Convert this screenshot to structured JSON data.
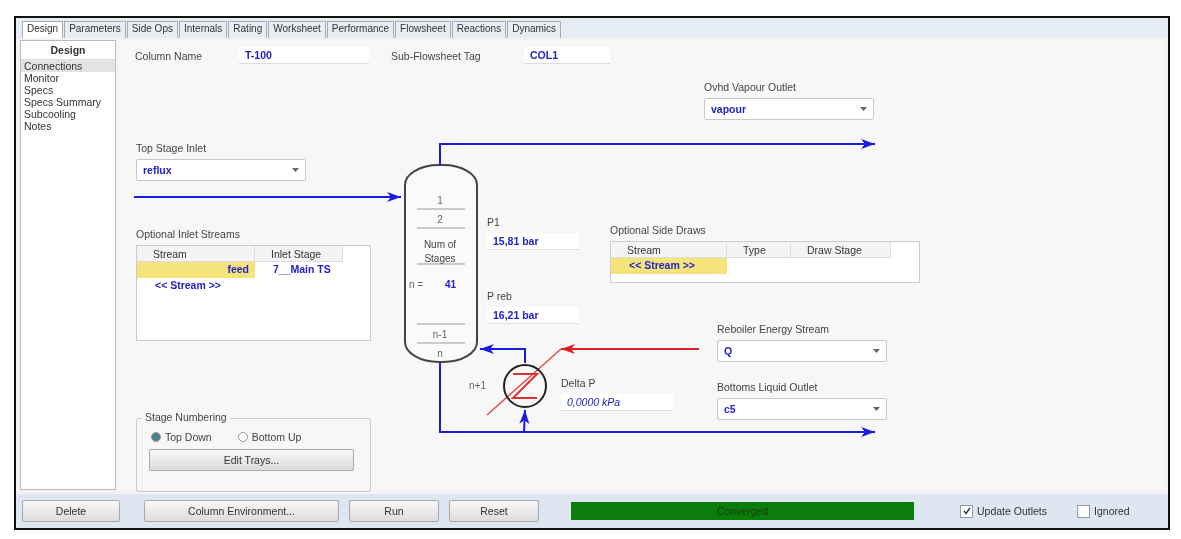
{
  "tabs": [
    {
      "label": "Design",
      "selected": true
    },
    {
      "label": "Parameters",
      "selected": false
    },
    {
      "label": "Side Ops",
      "selected": false
    },
    {
      "label": "Internals",
      "selected": false
    },
    {
      "label": "Rating",
      "selected": false
    },
    {
      "label": "Worksheet",
      "selected": false
    },
    {
      "label": "Performance",
      "selected": false
    },
    {
      "label": "Flowsheet",
      "selected": false
    },
    {
      "label": "Reactions",
      "selected": false
    },
    {
      "label": "Dynamics",
      "selected": false
    }
  ],
  "sidebar": {
    "title": "Design",
    "items": [
      {
        "label": "Connections",
        "selected": true
      },
      {
        "label": "Monitor",
        "selected": false
      },
      {
        "label": "Specs",
        "selected": false
      },
      {
        "label": "Specs Summary",
        "selected": false
      },
      {
        "label": "Subcooling",
        "selected": false
      },
      {
        "label": "Notes",
        "selected": false
      }
    ]
  },
  "column_name": {
    "label": "Column Name",
    "value": "T-100"
  },
  "sub_flowsheet_tag": {
    "label": "Sub-Flowsheet Tag",
    "value": "COL1"
  },
  "ovhd_vapour_outlet": {
    "label": "Ovhd Vapour Outlet",
    "value": "vapour"
  },
  "top_stage_inlet": {
    "label": "Top Stage Inlet",
    "value": "reflux"
  },
  "optional_inlet_streams": {
    "label": "Optional Inlet Streams",
    "columns": [
      "Stream",
      "Inlet Stage"
    ],
    "rows": [
      {
        "stream": "feed",
        "stage": "7__Main TS",
        "selected": true
      },
      {
        "stream": "<< Stream >>",
        "stage": "",
        "selected": false
      }
    ]
  },
  "column": {
    "stages": [
      "1",
      "2"
    ],
    "num_label": "Num of Stages",
    "n_label": "n =",
    "n_value": "41",
    "bottom_stages": [
      "n-1",
      "n"
    ],
    "reboiler_stage": "n+1"
  },
  "p1": {
    "label": "P1",
    "value": "15,81 bar"
  },
  "p_reb": {
    "label": "P reb",
    "value": "16,21 bar"
  },
  "delta_p": {
    "label": "Delta P",
    "value": "0,0000 kPa"
  },
  "optional_side_draws": {
    "label": "Optional Side Draws",
    "columns": [
      "Stream",
      "Type",
      "Draw Stage"
    ],
    "rows": [
      {
        "stream": "<< Stream >>",
        "selected": true
      }
    ]
  },
  "reboiler_energy_stream": {
    "label": "Reboiler Energy Stream",
    "value": "Q"
  },
  "bottoms_liquid_outlet": {
    "label": "Bottoms Liquid Outlet",
    "value": "c5"
  },
  "stage_numbering": {
    "label": "Stage Numbering",
    "options": [
      {
        "label": "Top Down",
        "selected": true
      },
      {
        "label": "Bottom Up",
        "selected": false
      }
    ],
    "button": "Edit Trays..."
  },
  "buttons": [
    "Delete",
    "Column Environment...",
    "Run",
    "Reset"
  ],
  "status": {
    "text": "Converged",
    "color": "#0a7d0a"
  },
  "checks": [
    {
      "label": "Update Outlets",
      "checked": true
    },
    {
      "label": "Ignored",
      "checked": false
    }
  ]
}
